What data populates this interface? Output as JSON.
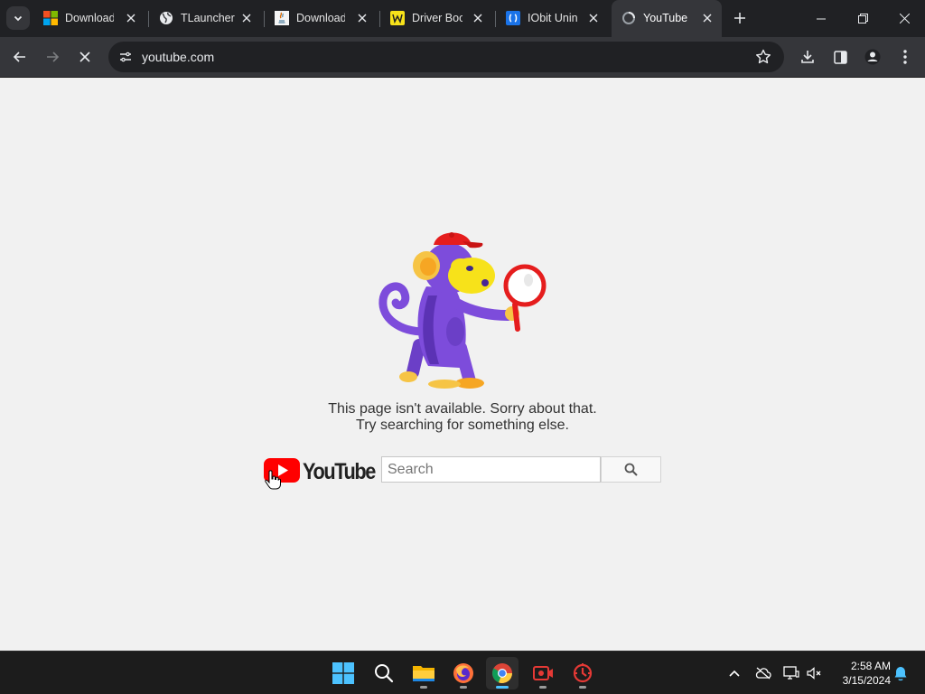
{
  "browser": {
    "tabs": [
      {
        "title": "Download",
        "favicon": "microsoft-icon"
      },
      {
        "title": "TLauncher",
        "favicon": "globe-icon"
      },
      {
        "title": "Download",
        "favicon": "java-icon"
      },
      {
        "title": "Driver Booster",
        "favicon": "driver-booster-icon"
      },
      {
        "title": "IObit Uninstaller",
        "favicon": "iobit-icon"
      },
      {
        "title": "YouTube",
        "favicon": "loading-icon",
        "active": true
      }
    ],
    "url": "youtube.com"
  },
  "page": {
    "message_line1": "This page isn't available. Sorry about that.",
    "message_line2": "Try searching for something else.",
    "logo_text": "YouTube",
    "search_placeholder": "Search"
  },
  "taskbar": {
    "apps": [
      "windows-start-icon",
      "search-icon",
      "file-explorer-icon",
      "firefox-icon",
      "chrome-icon",
      "screen-recorder-icon",
      "game-booster-icon"
    ],
    "time": "2:58 AM",
    "date": "3/15/2024"
  },
  "colors": {
    "youtube_red": "#ff0000",
    "chrome_dark": "#202124",
    "toolbar": "#35363a",
    "taskbar": "#1c1c1c",
    "accent": "#4cc2ff"
  }
}
